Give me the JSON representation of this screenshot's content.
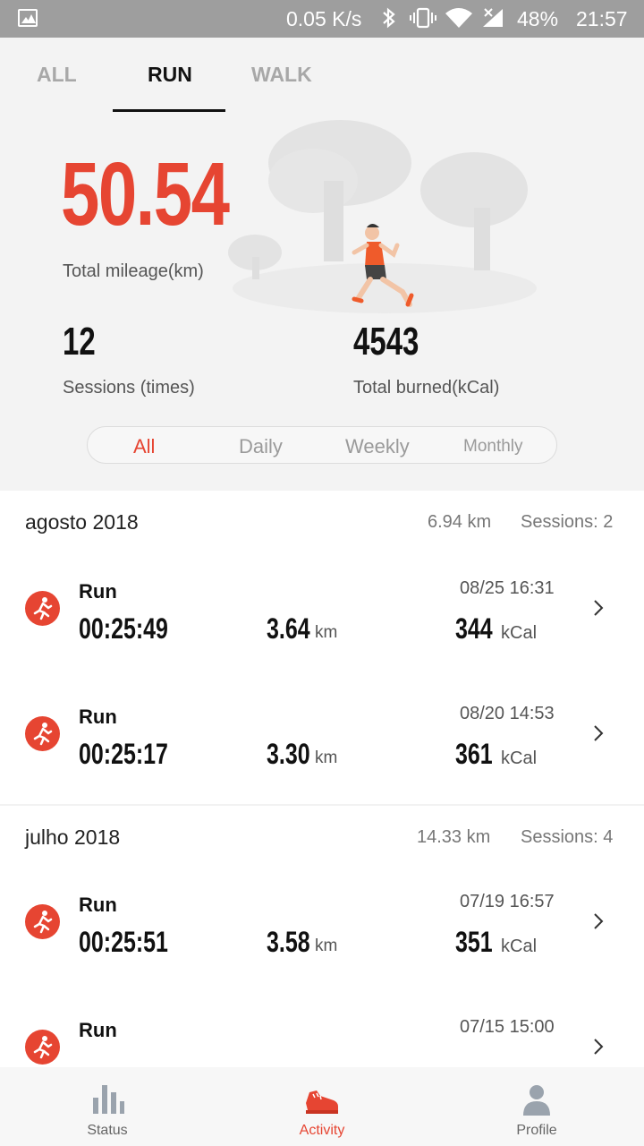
{
  "status_bar": {
    "speed": "0.05 K/s",
    "battery": "48%",
    "time": "21:57",
    "icons": [
      "gallery-icon",
      "bluetooth-icon",
      "vibrate-icon",
      "wifi-icon",
      "signal-icon",
      "battery-icon"
    ]
  },
  "tabs": [
    {
      "label": "ALL",
      "active": false
    },
    {
      "label": "RUN",
      "active": true
    },
    {
      "label": "WALK",
      "active": false
    }
  ],
  "summary": {
    "total_mileage": "50.54",
    "total_mileage_label": "Total mileage(km)",
    "sessions": "12",
    "sessions_label": "Sessions (times)",
    "burned": "4543",
    "burned_label": "Total burned(kCal)"
  },
  "period_filter": {
    "options": [
      "All",
      "Daily",
      "Weekly",
      "Monthly"
    ],
    "selected": "All"
  },
  "months": [
    {
      "name": "agosto 2018",
      "km": "6.94 km",
      "sessions": "Sessions: 2",
      "runs": [
        {
          "title": "Run",
          "date": "08/25  16:31",
          "duration": "00:25:49",
          "distance": "3.64",
          "distance_unit": "km",
          "kcal": "344",
          "kcal_unit": "kCal"
        },
        {
          "title": "Run",
          "date": "08/20  14:53",
          "duration": "00:25:17",
          "distance": "3.30",
          "distance_unit": "km",
          "kcal": "361",
          "kcal_unit": "kCal"
        }
      ]
    },
    {
      "name": "julho 2018",
      "km": "14.33 km",
      "sessions": "Sessions: 4",
      "runs": [
        {
          "title": "Run",
          "date": "07/19  16:57",
          "duration": "00:25:51",
          "distance": "3.58",
          "distance_unit": "km",
          "kcal": "351",
          "kcal_unit": "kCal"
        },
        {
          "title": "Run",
          "date": "07/15  15:00",
          "duration": "",
          "distance": "",
          "distance_unit": "",
          "kcal": "",
          "kcal_unit": ""
        }
      ]
    }
  ],
  "bottom_nav": [
    {
      "label": "Status",
      "icon": "bar-chart-icon",
      "active": false
    },
    {
      "label": "Activity",
      "icon": "shoe-icon",
      "active": true
    },
    {
      "label": "Profile",
      "icon": "person-icon",
      "active": false
    }
  ],
  "colors": {
    "accent": "#e64532",
    "header_bg": "#f3f3f3",
    "status_bar": "#9e9e9e"
  }
}
